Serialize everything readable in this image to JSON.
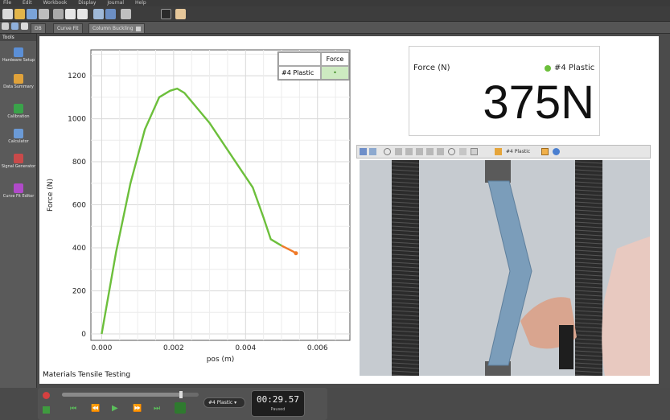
{
  "menu": [
    "File",
    "Edit",
    "Workbook",
    "Display",
    "Journal",
    "Help"
  ],
  "tabs": [
    {
      "label": "DB"
    },
    {
      "label": "Curve Fit"
    },
    {
      "label": "Column Buckling"
    }
  ],
  "tools_panel": {
    "header": "Tools",
    "items": [
      {
        "label": "Hardware Setup",
        "icon": "hardware-setup-icon",
        "color": "#5b8fd6"
      },
      {
        "label": "Data Summary",
        "icon": "data-summary-icon",
        "color": "#e0a23a"
      },
      {
        "label": "Calibration",
        "icon": "calibration-icon",
        "color": "#3aa34a"
      },
      {
        "label": "Calculator",
        "icon": "calculator-icon",
        "color": "#6b9ad6"
      },
      {
        "label": "Signal Generator",
        "icon": "signal-generator-icon",
        "color": "#c94a4a"
      },
      {
        "label": "Curve Fit Editor",
        "icon": "curve-fit-editor-icon",
        "color": "#b04ac9"
      }
    ]
  },
  "legend": {
    "header": "Force",
    "row_label": "#4 Plastic",
    "row_value": "•"
  },
  "meter": {
    "title": "Force (N)",
    "series": "#4 Plastic",
    "value": "375N",
    "series_color": "#6cbf3b"
  },
  "video_toolbar": {
    "series_label": "#4 Plastic"
  },
  "caption": "Materials Tensile Testing",
  "playback": {
    "time": "00:29.57",
    "status": "Paused",
    "run_select": "#4 Plastic"
  },
  "chart_data": {
    "type": "line",
    "xlabel": "pos (m)",
    "ylabel": "Force (N)",
    "xlim": [
      -0.0003,
      0.0069
    ],
    "ylim": [
      -30,
      1320
    ],
    "xticks": [
      0.0,
      0.002,
      0.004,
      0.006
    ],
    "xtick_labels": [
      "0.000",
      "0.002",
      "0.004",
      "0.006"
    ],
    "yticks": [
      0,
      200,
      400,
      600,
      800,
      1000,
      1200
    ],
    "grid": true,
    "series": [
      {
        "name": "#4 Plastic",
        "color": "#6cbf3b",
        "end_color": "#f07a28",
        "x": [
          0.0,
          0.0004,
          0.0008,
          0.0012,
          0.0016,
          0.0019,
          0.0021,
          0.0023,
          0.0026,
          0.003,
          0.0034,
          0.0038,
          0.0042,
          0.0045,
          0.0047,
          0.005,
          0.0053,
          0.0054
        ],
        "y": [
          0,
          380,
          700,
          950,
          1100,
          1130,
          1140,
          1120,
          1060,
          980,
          880,
          780,
          680,
          540,
          440,
          410,
          385,
          375
        ]
      }
    ]
  }
}
